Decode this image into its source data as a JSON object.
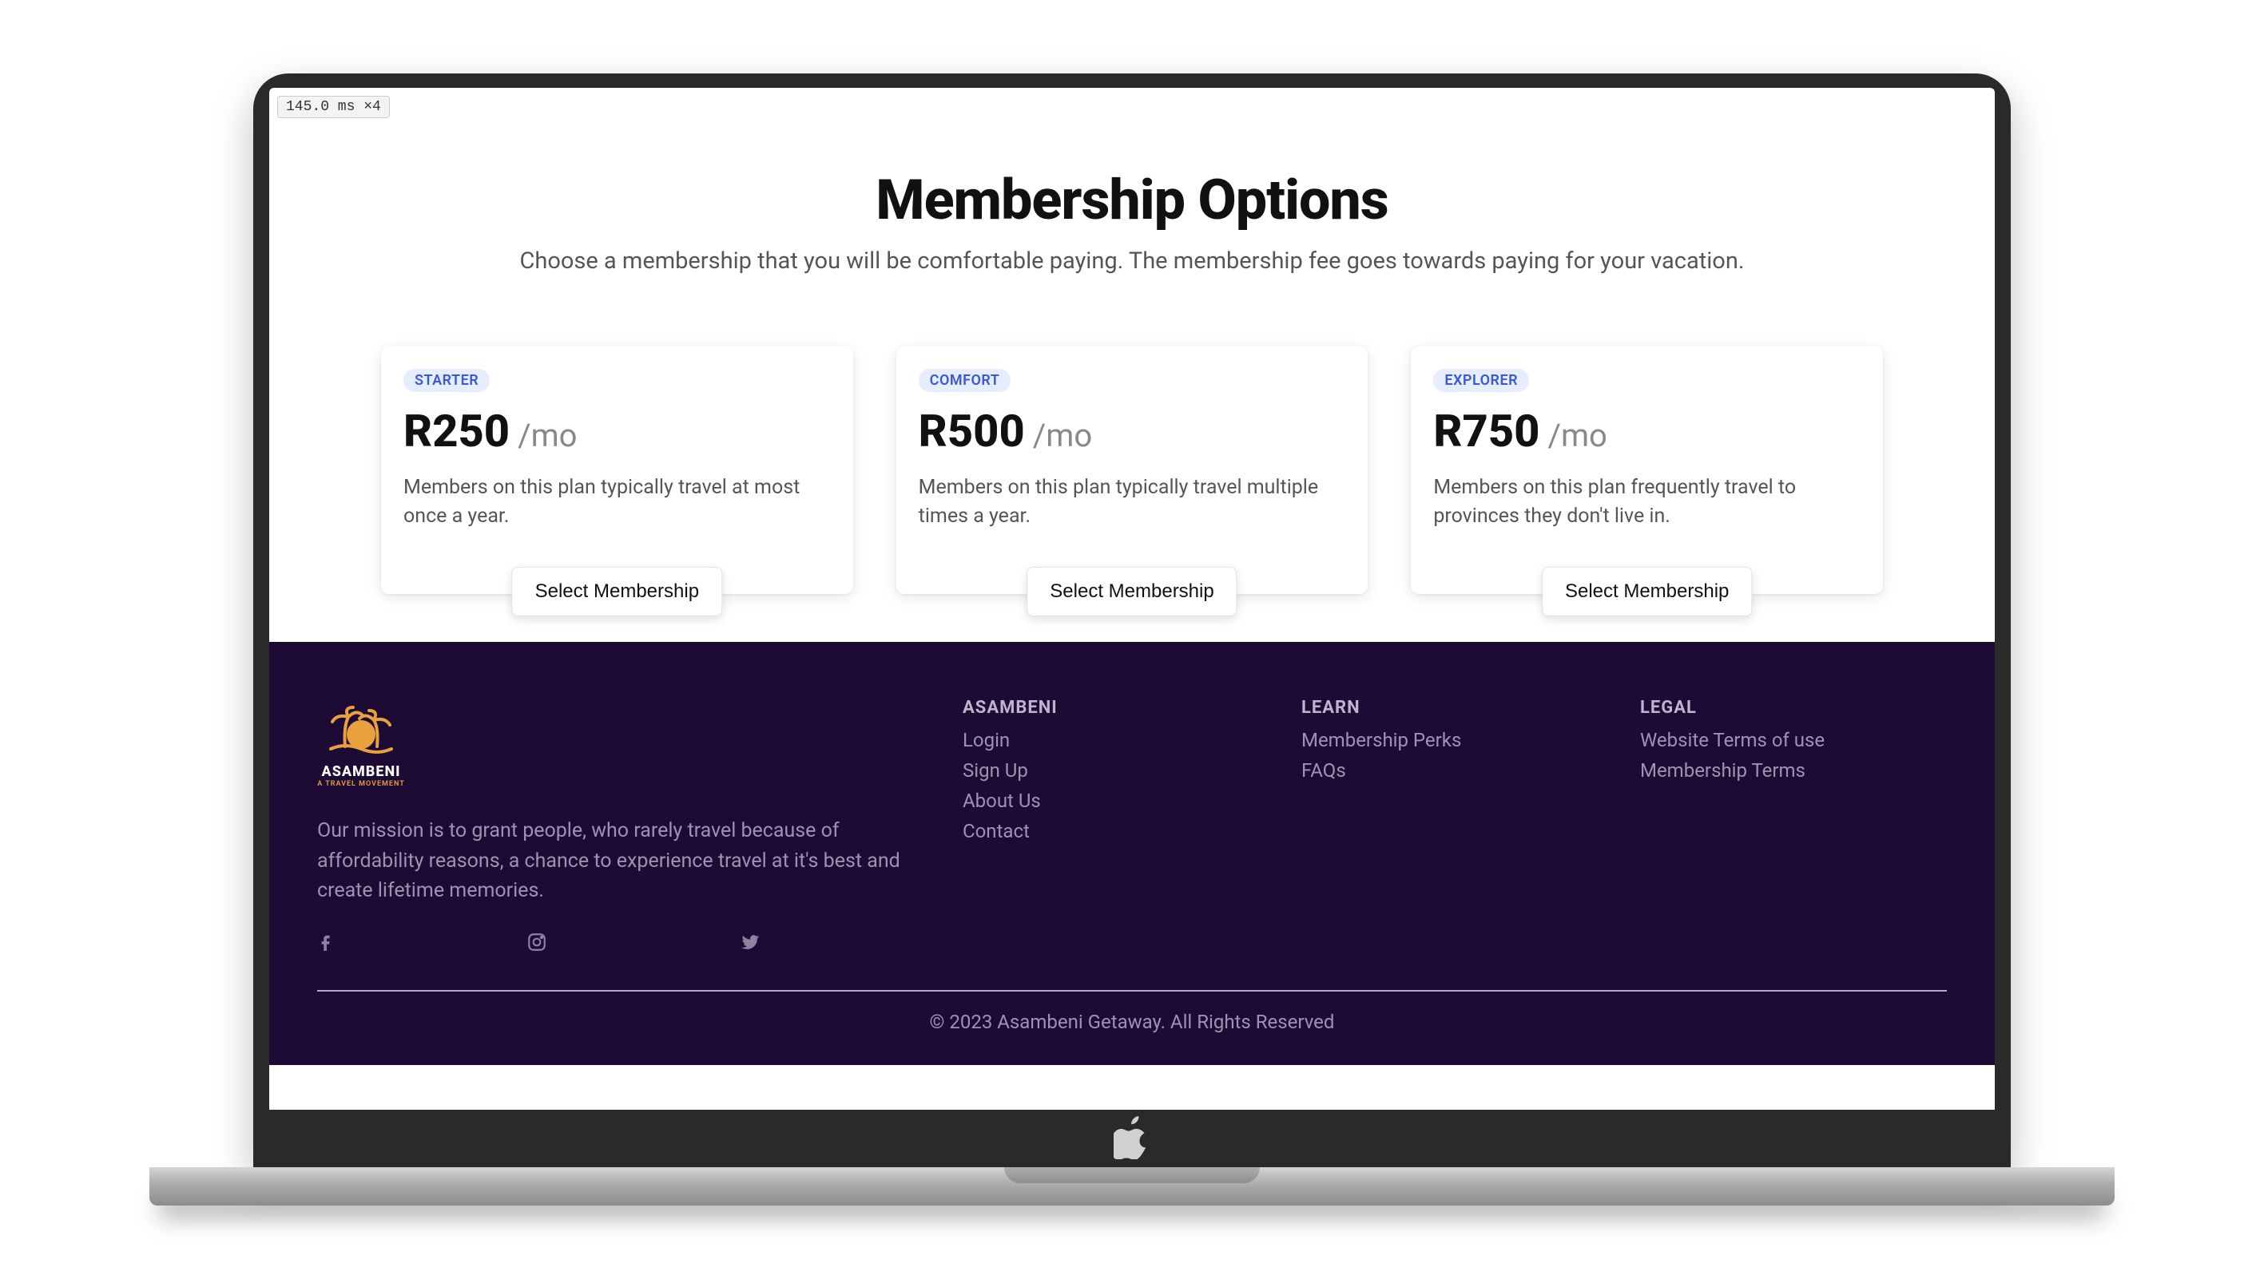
{
  "perf": {
    "text": "145.0 ms ×4"
  },
  "header": {
    "title": "Membership Options",
    "subtitle": "Choose a membership that you will be comfortable paying. The membership fee goes towards paying for your vacation."
  },
  "plans": [
    {
      "badge": "STARTER",
      "price": "R250",
      "period": "/mo",
      "desc": "Members on this plan typically travel at most once a year.",
      "cta": "Select Membership"
    },
    {
      "badge": "COMFORT",
      "price": "R500",
      "period": "/mo",
      "desc": "Members on this plan typically travel multiple times a year.",
      "cta": "Select Membership"
    },
    {
      "badge": "EXPLORER",
      "price": "R750",
      "period": "/mo",
      "desc": "Members on this plan frequently travel to provinces they don't live in.",
      "cta": "Select Membership"
    }
  ],
  "footer": {
    "brand_name": "ASAMBENI",
    "brand_tag": "A TRAVEL MOVEMENT",
    "mission": "Our mission is to grant people, who rarely travel because of affordability reasons, a chance to experience travel at it's best and create lifetime memories.",
    "columns": [
      {
        "head": "ASAMBENI",
        "links": [
          "Login",
          "Sign Up",
          "About Us",
          "Contact"
        ]
      },
      {
        "head": "LEARN",
        "links": [
          "Membership Perks",
          "FAQs"
        ]
      },
      {
        "head": "LEGAL",
        "links": [
          "Website Terms of use",
          "Membership Terms"
        ]
      }
    ],
    "copyright": "© 2023 Asambeni Getaway. All Rights Reserved"
  }
}
